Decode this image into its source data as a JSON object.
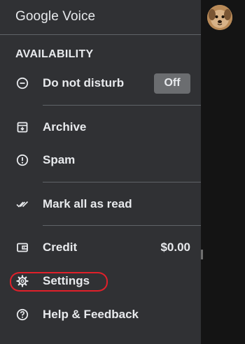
{
  "app": {
    "title": "Google Voice"
  },
  "profile": {
    "avatar_icon": "dog-avatar-icon"
  },
  "availability": {
    "heading": "AVAILABILITY",
    "do_not_disturb": {
      "label": "Do not disturb",
      "state": "Off",
      "icon": "minus-circle-icon"
    }
  },
  "menu": {
    "archive": {
      "label": "Archive",
      "icon": "archive-icon"
    },
    "spam": {
      "label": "Spam",
      "icon": "alert-circle-icon"
    },
    "mark_all_read": {
      "label": "Mark all as read",
      "icon": "done-all-icon"
    },
    "credit": {
      "label": "Credit",
      "value": "$0.00",
      "icon": "wallet-icon"
    },
    "settings": {
      "label": "Settings",
      "icon": "gear-icon"
    },
    "help": {
      "label": "Help & Feedback",
      "icon": "help-circle-icon"
    }
  },
  "colors": {
    "drawer_bg": "#303134",
    "text": "#e8eaed",
    "divider": "#5f6368",
    "toggle_bg": "#6b6d70",
    "annotation": "#e0202a"
  }
}
